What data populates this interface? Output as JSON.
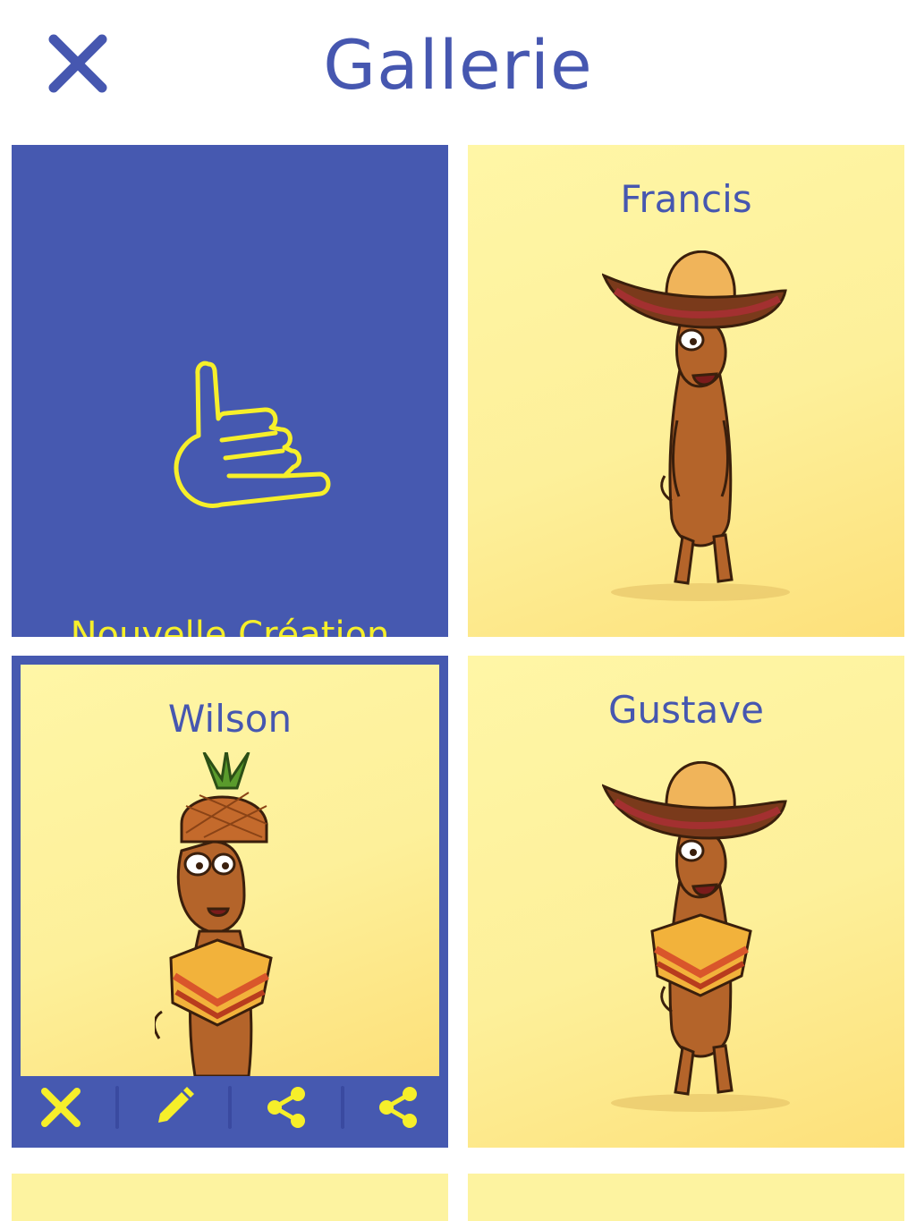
{
  "header": {
    "title": "Gallerie",
    "close_icon": "close-icon"
  },
  "colors": {
    "brand_blue": "#4657b0",
    "card_blue": "#4659b0",
    "accent_yellow": "#f6ef2a",
    "card_yellow": "#fdf09a"
  },
  "gallery": {
    "new_creation_label": "Nouvelle Création",
    "new_creation_icon": "shaka-hand-icon",
    "items": [
      {
        "name": "Francis"
      },
      {
        "name": "Wilson"
      },
      {
        "name": "Gustave"
      }
    ],
    "action_bar_icons": [
      "close-icon",
      "pencil-icon",
      "share-icon",
      "share-icon"
    ]
  }
}
